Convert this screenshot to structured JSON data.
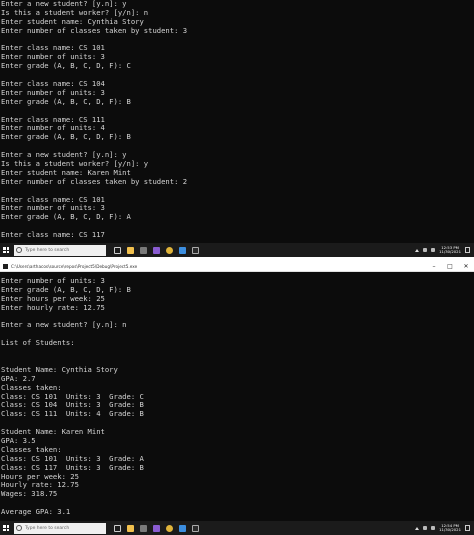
{
  "console_top": {
    "lines": [
      "Enter a new student? [y.n]: y",
      "Is this a student worker? [y/n]: n",
      "Enter student name: Cynthia Story",
      "Enter number of classes taken by student: 3",
      "",
      "Enter class name: CS 101",
      "Enter number of units: 3",
      "Enter grade (A, B, C, D, F): C",
      "",
      "Enter class name: CS 104",
      "Enter number of units: 3",
      "Enter grade (A, B, C, D, F): B",
      "",
      "Enter class name: CS 111",
      "Enter number of units: 4",
      "Enter grade (A, B, C, D, F): B",
      "",
      "Enter a new student? [y.n]: y",
      "Is this a student worker? [y/n]: y",
      "Enter student name: Karen Mint",
      "Enter number of classes taken by student: 2",
      "",
      "Enter class name: CS 101",
      "Enter number of units: 3",
      "Enter grade (A, B, C, D, F): A",
      "",
      "Enter class name: CS 117"
    ]
  },
  "console_bottom": {
    "lines": [
      "Enter number of units: 3",
      "Enter grade (A, B, C, D, F): B",
      "Enter hours per week: 25",
      "Enter hourly rate: 12.75",
      "",
      "Enter a new student? [y.n]: n",
      "",
      "List of Students:",
      "",
      "",
      "Student Name: Cynthia Story",
      "GPA: 2.7",
      "Classes taken:",
      "Class: CS 101  Units: 3  Grade: C",
      "Class: CS 104  Units: 3  Grade: B",
      "Class: CS 111  Units: 4  Grade: B",
      "",
      "Student Name: Karen Mint",
      "GPA: 3.5",
      "Classes taken:",
      "Class: CS 101  Units: 3  Grade: A",
      "Class: CS 117  Units: 3  Grade: B",
      "Hours per week: 25",
      "Hourly rate: 12.75",
      "Wages: 318.75",
      "",
      "Average GPA: 3.1"
    ]
  },
  "window": {
    "title": "C:\\Users\\arthacos\\source\\repos\\Project5\\Debug\\Project5.exe",
    "minimize": "–",
    "maximize": "□",
    "close": "✕"
  },
  "taskbar_top": {
    "search_placeholder": "Type here to search",
    "time": "12:53 PM",
    "date": "11/30/2021"
  },
  "taskbar_bottom": {
    "search_placeholder": "Type here to search",
    "time": "12:54 PM",
    "date": "11/30/2021"
  },
  "icons": {
    "start": "windows-logo",
    "search": "search-icon",
    "tray": "chevron-up-icon"
  },
  "colors": {
    "console_bg": "#0c0c0c",
    "console_text": "#d4d4d4",
    "taskbar_bg": "#1b1b1b"
  }
}
